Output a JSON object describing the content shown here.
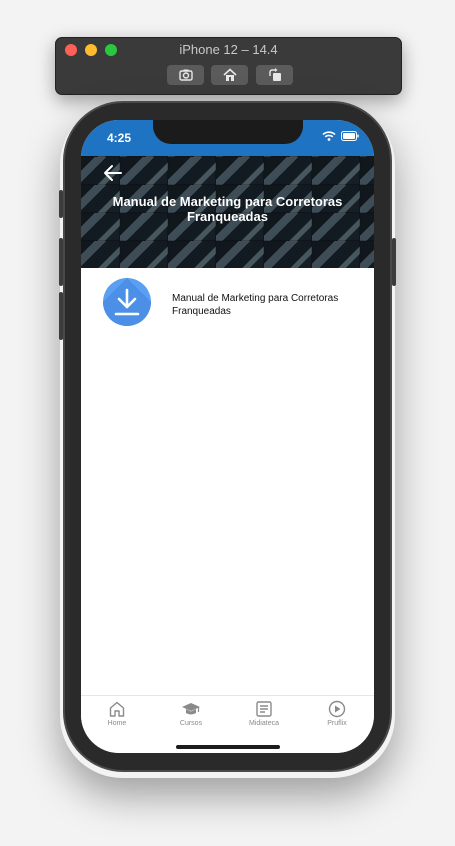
{
  "simulator": {
    "title": "iPhone 12 – 14.4"
  },
  "status_bar": {
    "time": "4:25",
    "color": "#1e73c2"
  },
  "header": {
    "title": "Manual de Marketing para Corretoras Franqueadas",
    "back_icon": "arrow-left-icon"
  },
  "list": {
    "items": [
      {
        "label": "Manual de Marketing para Corretoras Franqueadas",
        "icon": "download-icon",
        "icon_color": "#5a9ff2"
      }
    ]
  },
  "tabbar": {
    "tabs": [
      {
        "label": "Home",
        "icon": "home-icon"
      },
      {
        "label": "Cursos",
        "icon": "graduation-cap-icon"
      },
      {
        "label": "Midiateca",
        "icon": "document-icon"
      },
      {
        "label": "Pruflix",
        "icon": "play-circle-icon"
      }
    ]
  }
}
